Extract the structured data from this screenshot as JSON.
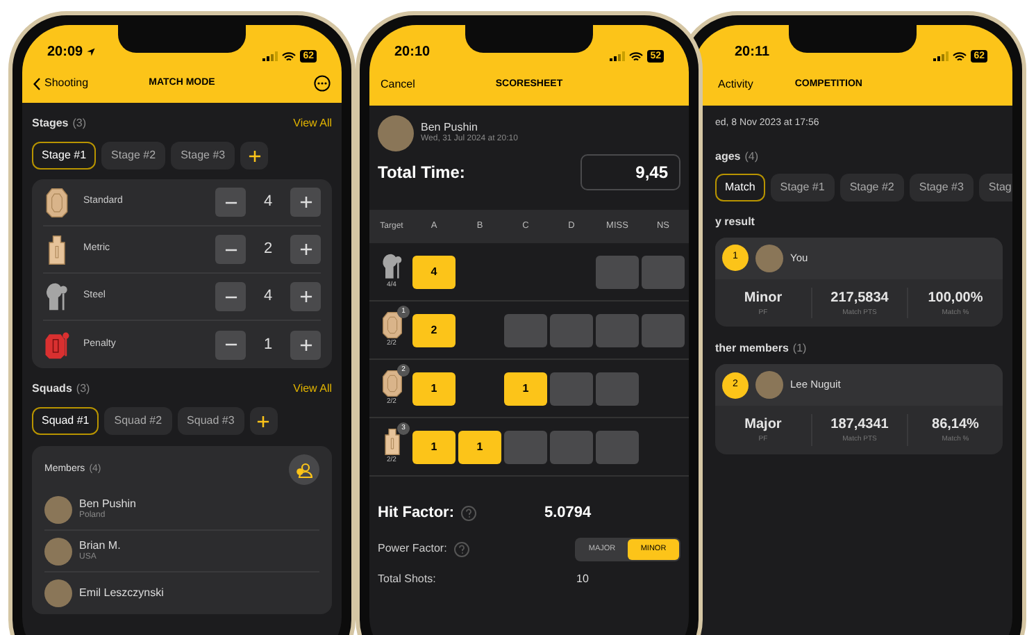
{
  "match_mode": {
    "status": {
      "time": "20:09",
      "location_arrow": true,
      "battery": "62"
    },
    "nav": {
      "back": "Shooting",
      "title": "MATCH MODE"
    },
    "stages": {
      "title": "Stages",
      "count": "(3)",
      "view_all": "View All",
      "tabs": [
        {
          "label": "Stage #1",
          "selected": true
        },
        {
          "label": "Stage #2",
          "selected": false
        },
        {
          "label": "Stage #3",
          "selected": false
        }
      ],
      "targets": [
        {
          "kind": "standard",
          "name": "Standard",
          "count": "4"
        },
        {
          "kind": "metric",
          "name": "Metric",
          "count": "2"
        },
        {
          "kind": "steel",
          "name": "Steel",
          "count": "4"
        },
        {
          "kind": "penalty",
          "name": "Penalty",
          "count": "1"
        }
      ]
    },
    "squads": {
      "title": "Squads",
      "count": "(3)",
      "view_all": "View All",
      "tabs": [
        {
          "label": "Squad #1",
          "selected": true
        },
        {
          "label": "Squad #2",
          "selected": false
        },
        {
          "label": "Squad #3",
          "selected": false
        }
      ]
    },
    "members": {
      "title": "Members",
      "count": "(4)",
      "list": [
        {
          "name": "Ben Pushin",
          "country": "Poland"
        },
        {
          "name": "Brian M.",
          "country": "USA"
        },
        {
          "name": "Emil Leszczynski"
        }
      ]
    }
  },
  "scoresheet": {
    "status": {
      "time": "20:10",
      "battery": "52"
    },
    "nav": {
      "cancel": "Cancel",
      "title": "SCORESHEET"
    },
    "shooter": {
      "name": "Ben Pushin",
      "date": "Wed, 31 Jul 2024 at 20:10"
    },
    "total_time": {
      "label": "Total Time:",
      "value": "9,45"
    },
    "table": {
      "target_column": "Target",
      "columns": [
        "A",
        "B",
        "C",
        "D",
        "MISS",
        "NS"
      ],
      "rows": [
        {
          "kind": "steel",
          "hits": "4/4",
          "cells": [
            {
              "kind": "hit",
              "value": "4"
            },
            {
              "kind": "blank"
            },
            {
              "kind": "blank"
            },
            {
              "kind": "blank"
            },
            {
              "kind": "slot"
            },
            {
              "kind": "slot"
            }
          ]
        },
        {
          "kind": "standard",
          "badge": "1",
          "hits": "2/2",
          "cells": [
            {
              "kind": "hit",
              "value": "2"
            },
            {
              "kind": "blank"
            },
            {
              "kind": "slot"
            },
            {
              "kind": "slot"
            },
            {
              "kind": "slot"
            },
            {
              "kind": "slot"
            }
          ]
        },
        {
          "kind": "standard",
          "badge": "2",
          "hits": "2/2",
          "cells": [
            {
              "kind": "hit",
              "value": "1"
            },
            {
              "kind": "blank"
            },
            {
              "kind": "hit",
              "value": "1"
            },
            {
              "kind": "slot"
            },
            {
              "kind": "slot"
            },
            {
              "kind": "blank"
            }
          ]
        },
        {
          "kind": "metric",
          "badge": "3",
          "hits": "2/2",
          "cells": [
            {
              "kind": "hit",
              "value": "1"
            },
            {
              "kind": "hit",
              "value": "1"
            },
            {
              "kind": "slot"
            },
            {
              "kind": "slot"
            },
            {
              "kind": "slot"
            },
            {
              "kind": "blank"
            }
          ]
        }
      ]
    },
    "hit_factor": {
      "label": "Hit Factor:",
      "value": "5.0794"
    },
    "power_factor": {
      "label": "Power Factor:",
      "options": [
        {
          "label": "MAJOR",
          "selected": false
        },
        {
          "label": "MINOR",
          "selected": true
        }
      ]
    },
    "total_shots": {
      "label": "Total Shots:",
      "value": "10"
    }
  },
  "competition": {
    "status": {
      "time": "20:11",
      "battery": "62"
    },
    "nav": {
      "back": "Activity",
      "title": "COMPETITION"
    },
    "date": "ed, 8 Nov 2023 at 17:56",
    "stages": {
      "title": "ages",
      "count": "(4)",
      "tabs": [
        {
          "label": "Match",
          "selected": true
        },
        {
          "label": "Stage #1",
          "selected": false
        },
        {
          "label": "Stage #2",
          "selected": false
        },
        {
          "label": "Stage #3",
          "selected": false
        },
        {
          "label": "Stag",
          "selected": false
        }
      ]
    },
    "my_result": {
      "title": "y result",
      "entries": [
        {
          "rank": "1",
          "name": "You",
          "stats": [
            {
              "value": "Minor",
              "label": "PF"
            },
            {
              "value": "217,5834",
              "label": "Match PTS"
            },
            {
              "value": "100,00%",
              "label": "Match %"
            }
          ]
        }
      ]
    },
    "others": {
      "title": "ther members",
      "count": "(1)",
      "entries": [
        {
          "rank": "2",
          "name": "Lee Nuguit",
          "stats": [
            {
              "value": "Major",
              "label": "PF"
            },
            {
              "value": "187,4341",
              "label": "Match PTS"
            },
            {
              "value": "86,14%",
              "label": "Match %"
            }
          ]
        }
      ]
    }
  }
}
